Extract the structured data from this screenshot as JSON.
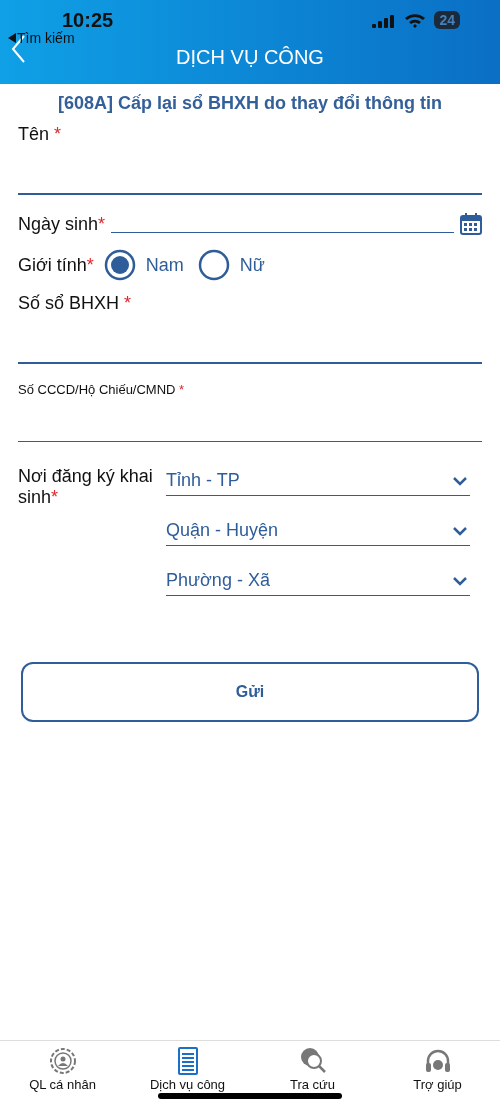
{
  "status_bar": {
    "time": "10:25",
    "battery": "24"
  },
  "header": {
    "back_label": "Tìm kiếm",
    "title": "DỊCH VỤ CÔNG"
  },
  "form_title": "[608A] Cấp lại sổ BHXH do thay đổi thông tin",
  "fields": [
    {
      "kind": "text",
      "label": "Tên",
      "mark": "*"
    },
    {
      "kind": "date",
      "label": "Ngày sinh",
      "mark": "*"
    },
    {
      "kind": "radio",
      "label": "Giới tính",
      "mark": "*",
      "options": [
        {
          "label": "Nam",
          "selected": true
        },
        {
          "label": "Nữ",
          "selected": false
        }
      ]
    },
    {
      "kind": "text",
      "label": "Số sổ BHXH",
      "mark": "*"
    },
    {
      "kind": "small",
      "label": "Số CCCD/Hộ Chiếu/CMND",
      "mark": "*"
    }
  ],
  "birthplace": {
    "label": "Nơi đăng ký khai sinh",
    "mark": "*",
    "dropdowns": [
      "Tỉnh - TP",
      "Quận - Huyện",
      "Phường - Xã"
    ]
  },
  "submit": "Gửi",
  "tab_bar": [
    {
      "label": "QL cá nhân",
      "selected": false
    },
    {
      "label": "Dịch vụ công",
      "selected": true
    },
    {
      "label": "Tra cứu",
      "selected": false
    },
    {
      "label": "Trợ giúp",
      "selected": false
    }
  ]
}
